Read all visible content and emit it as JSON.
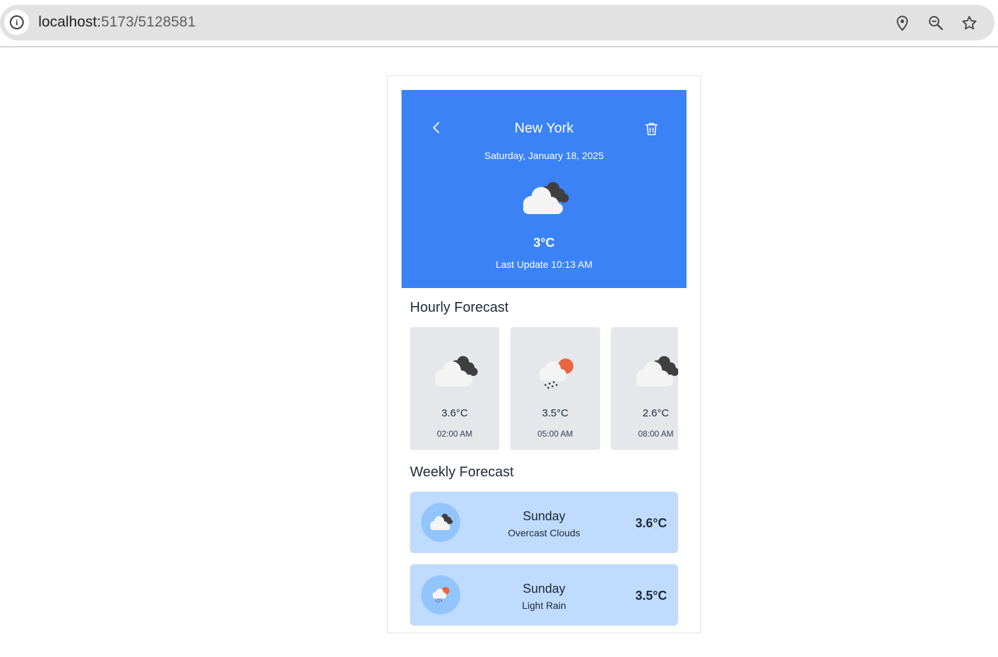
{
  "browser": {
    "url_host": "localhost:",
    "url_path": "5173/5128581"
  },
  "header": {
    "city": "New York",
    "date": "Saturday, January 18, 2025",
    "temperature": "3°C",
    "last_update": "Last Update 10:13 AM",
    "icon": "overcast-clouds-icon",
    "background_color": "#3b82f6"
  },
  "hourly": {
    "title": "Hourly Forecast",
    "items": [
      {
        "temp": "3.6°C",
        "time": "02:00 AM",
        "icon": "overcast-clouds-icon"
      },
      {
        "temp": "3.5°C",
        "time": "05:00 AM",
        "icon": "light-rain-icon"
      },
      {
        "temp": "2.6°C",
        "time": "08:00 AM",
        "icon": "overcast-clouds-icon"
      }
    ]
  },
  "weekly": {
    "title": "Weekly Forecast",
    "items": [
      {
        "day": "Sunday",
        "description": "Overcast Clouds",
        "temp": "3.6°C",
        "icon": "overcast-clouds-icon"
      },
      {
        "day": "Sunday",
        "description": "Light Rain",
        "temp": "3.5°C",
        "icon": "light-rain-icon"
      }
    ]
  }
}
